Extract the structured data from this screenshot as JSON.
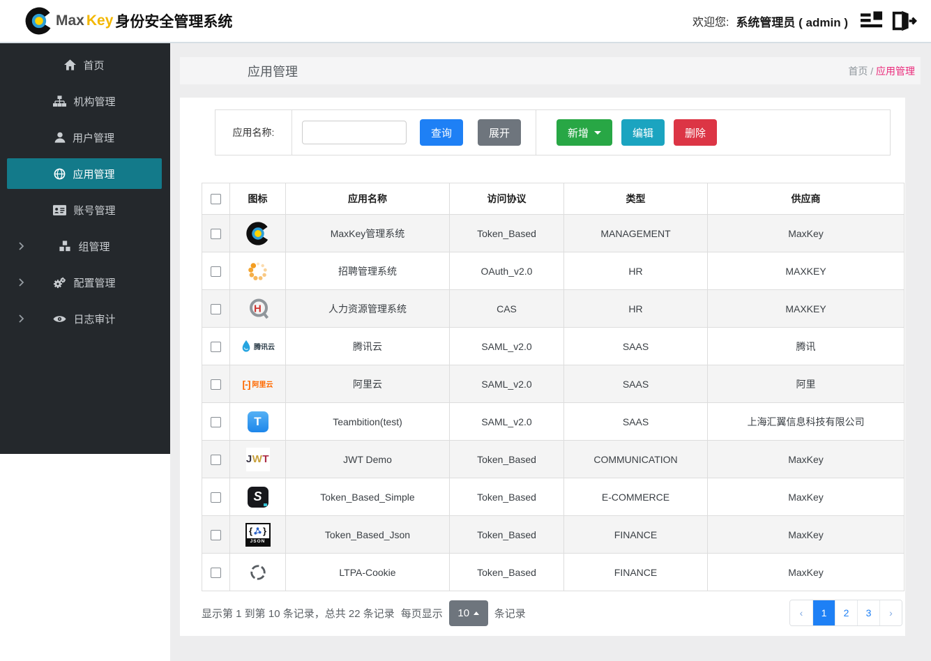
{
  "colors": {
    "primary_blue": "#1e80f5",
    "success_green": "#28a745",
    "info_teal": "#1ba4c0",
    "danger_red": "#dc3545",
    "secondary_gray": "#6e757d",
    "sidebar_active_teal": "#137a8a",
    "breadcrumb_pink": "#ea2a7b",
    "brand_yellow": "#f3b700"
  },
  "header": {
    "brand": {
      "part1": "Max",
      "part2": "Key",
      "part3": "身份安全管理系统"
    },
    "welcome_label": "欢迎您:",
    "user": "系统管理员 ( admin )"
  },
  "sidebar": {
    "items": [
      {
        "key": "home",
        "label": "首页",
        "icon": "home-icon",
        "active": false,
        "expandable": false
      },
      {
        "key": "org",
        "label": "机构管理",
        "icon": "sitemap-icon",
        "active": false,
        "expandable": false
      },
      {
        "key": "user",
        "label": "用户管理",
        "icon": "user-icon",
        "active": false,
        "expandable": false
      },
      {
        "key": "app",
        "label": "应用管理",
        "icon": "globe-icon",
        "active": true,
        "expandable": false
      },
      {
        "key": "account",
        "label": "账号管理",
        "icon": "id-card-icon",
        "active": false,
        "expandable": false
      },
      {
        "key": "group",
        "label": "组管理",
        "icon": "cubes-icon",
        "active": false,
        "expandable": true
      },
      {
        "key": "config",
        "label": "配置管理",
        "icon": "gears-icon",
        "active": false,
        "expandable": true
      },
      {
        "key": "audit",
        "label": "日志审计",
        "icon": "eye-icon",
        "active": false,
        "expandable": true
      }
    ]
  },
  "page": {
    "title": "应用管理",
    "breadcrumb": {
      "root": "首页",
      "separator": " / ",
      "current": "应用管理"
    }
  },
  "toolbar": {
    "search_label": "应用名称:",
    "search_value": "",
    "query_label": "查询",
    "expand_label": "展开",
    "add_label": "新增",
    "edit_label": "编辑",
    "delete_label": "删除"
  },
  "table": {
    "columns": [
      "图标",
      "应用名称",
      "访问协议",
      "类型",
      "供应商"
    ],
    "rows": [
      {
        "icon": "maxkey-logo",
        "name": "MaxKey管理系统",
        "protocol": "Token_Based",
        "type": "MANAGEMENT",
        "vendor": "MaxKey"
      },
      {
        "icon": "dots-spinner-logo",
        "name": "招聘管理系统",
        "protocol": "OAuth_v2.0",
        "type": "HR",
        "vendor": "MAXKEY"
      },
      {
        "icon": "hr-logo",
        "name": "人力资源管理系统",
        "protocol": "CAS",
        "type": "HR",
        "vendor": "MAXKEY"
      },
      {
        "icon": "tencent-cloud-logo",
        "name": "腾讯云",
        "protocol": "SAML_v2.0",
        "type": "SAAS",
        "vendor": "腾讯"
      },
      {
        "icon": "aliyun-logo",
        "name": "阿里云",
        "protocol": "SAML_v2.0",
        "type": "SAAS",
        "vendor": "阿里"
      },
      {
        "icon": "teambition-logo",
        "name": "Teambition(test)",
        "protocol": "SAML_v2.0",
        "type": "SAAS",
        "vendor": "上海汇翼信息科技有限公司"
      },
      {
        "icon": "jwt-logo",
        "name": "JWT Demo",
        "protocol": "Token_Based",
        "type": "COMMUNICATION",
        "vendor": "MaxKey"
      },
      {
        "icon": "s-letter-logo",
        "name": "Token_Based_Simple",
        "protocol": "Token_Based",
        "type": "E-COMMERCE",
        "vendor": "MaxKey"
      },
      {
        "icon": "json-logo",
        "name": "Token_Based_Json",
        "protocol": "Token_Based",
        "type": "FINANCE",
        "vendor": "MaxKey"
      },
      {
        "icon": "target-circle-logo",
        "name": "LTPA-Cookie",
        "protocol": "Token_Based",
        "type": "FINANCE",
        "vendor": "MaxKey"
      }
    ]
  },
  "pagination": {
    "summary": "显示第 1 到第 10 条记录，总共 22 条记录",
    "per_page_prefix": "每页显示",
    "page_size": "10",
    "per_page_suffix": "条记录",
    "prev_label": "‹",
    "next_label": "›",
    "pages": [
      {
        "label": "1",
        "active": true
      },
      {
        "label": "2",
        "active": false
      },
      {
        "label": "3",
        "active": false
      }
    ]
  }
}
